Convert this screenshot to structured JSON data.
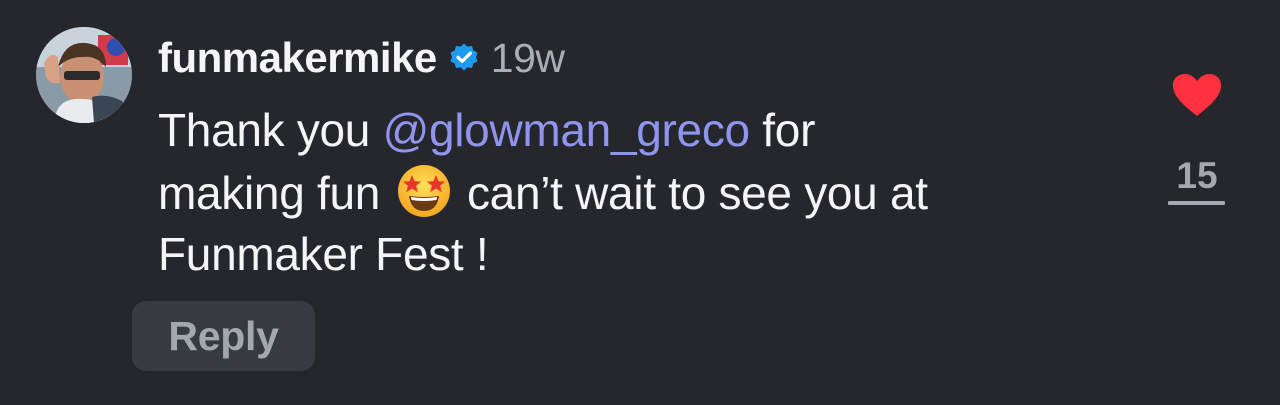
{
  "comment": {
    "username": "funmakermike",
    "verified_icon": "verified-badge-icon",
    "timestamp": "19w",
    "text": {
      "prefix": "Thank you ",
      "mention": "@glowman_greco",
      "after_mention": " for",
      "line2_start": "making fun ",
      "emoji": "star-struck-emoji",
      "line2_end": " can’t wait to see you at",
      "line3": "Funmaker Fest !"
    },
    "reply_label": "Reply",
    "like_icon": "heart-icon",
    "like_count": "15"
  },
  "colors": {
    "background": "#25272c",
    "mention": "#8f95ee",
    "verified": "#1d9bf0",
    "like": "#ff3040",
    "muted": "#a3a8af"
  }
}
